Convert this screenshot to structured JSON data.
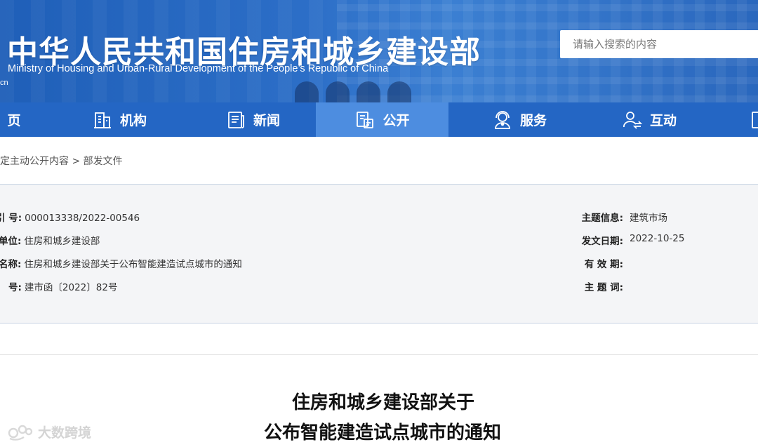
{
  "header": {
    "site_title": "中华人民共和国住房和城乡建设部",
    "site_subtitle": "Ministry of Housing and Urban-Rural Development of the People’s Republic of China",
    "domain_fragment": "cn",
    "search_placeholder": "请输入搜索的内容"
  },
  "nav": {
    "items": [
      {
        "label": "页",
        "icon": "home-icon"
      },
      {
        "label": "机构",
        "icon": "building-icon"
      },
      {
        "label": "新闻",
        "icon": "newspaper-icon"
      },
      {
        "label": "公开",
        "icon": "document-icon",
        "active": true
      },
      {
        "label": "服务",
        "icon": "service-person-icon"
      },
      {
        "label": "互动",
        "icon": "interaction-icon"
      }
    ]
  },
  "breadcrumb": {
    "text": "定主动公开内容 > 部发文件"
  },
  "info": {
    "left": [
      {
        "label": "引  号:",
        "value": "000013338/2022-00546"
      },
      {
        "label": "单位:",
        "value": "住房和城乡建设部"
      },
      {
        "label": "名称:",
        "value": "住房和城乡建设部关于公布智能建造试点城市的通知"
      },
      {
        "label": "号:",
        "value": "建市函〔2022〕82号"
      }
    ],
    "right": [
      {
        "label": "主题信息:",
        "value": "建筑市场"
      },
      {
        "label": "发文日期:",
        "value": "2022-10-25"
      },
      {
        "label": "有 效 期:",
        "value": ""
      },
      {
        "label": "主 题 词:",
        "value": ""
      }
    ]
  },
  "document": {
    "title_line1": "住房和城乡建设部关于",
    "title_line2": "公布智能建造试点城市的通知"
  },
  "watermark": {
    "text": "大数跨境"
  },
  "colors": {
    "header_blue": "#2c6ec7",
    "nav_blue": "#2466c4",
    "nav_active": "#4d8de0",
    "info_bg": "#f4f5f7"
  }
}
